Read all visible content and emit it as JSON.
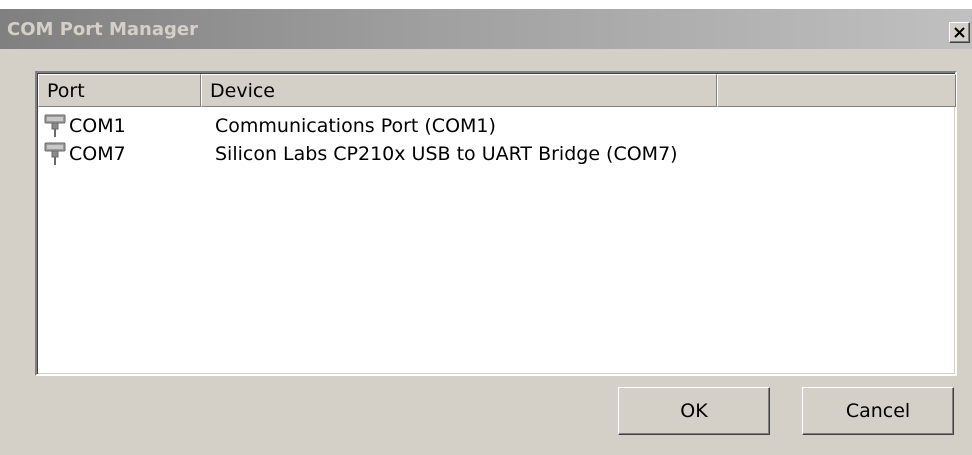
{
  "window": {
    "title": "COM Port Manager",
    "close_symbol": "X"
  },
  "list": {
    "columns": [
      "Port",
      "Device",
      ""
    ],
    "rows": [
      {
        "icon": "serial-port-icon",
        "port": "COM1",
        "device": "Communications Port (COM1)"
      },
      {
        "icon": "serial-port-icon",
        "port": "COM7",
        "device": "Silicon Labs CP210x USB to UART Bridge (COM7)"
      }
    ]
  },
  "buttons": {
    "ok_label": "OK",
    "cancel_label": "Cancel"
  }
}
